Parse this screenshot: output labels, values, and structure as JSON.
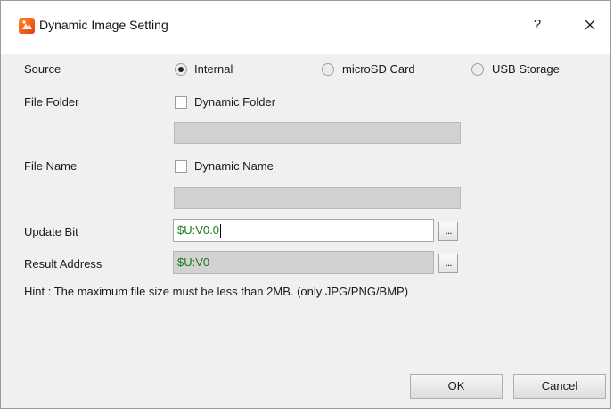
{
  "window": {
    "title": "Dynamic Image Setting",
    "help_label": "?",
    "close_label": "×",
    "icons": {
      "app": "app-logo-icon",
      "close": "close-icon"
    }
  },
  "source": {
    "label": "Source",
    "options": [
      {
        "label": "Internal",
        "checked": true
      },
      {
        "label": "microSD Card",
        "checked": false
      },
      {
        "label": "USB Storage",
        "checked": false
      }
    ]
  },
  "file_folder": {
    "label": "File Folder",
    "checkbox_label": "Dynamic Folder",
    "checked": false,
    "value": ""
  },
  "file_name": {
    "label": "File Name",
    "checkbox_label": "Dynamic Name",
    "checked": false,
    "value": ""
  },
  "update_bit": {
    "label": "Update Bit",
    "value": "$U:V0.0",
    "browse_label": "..."
  },
  "result_address": {
    "label": "Result Address",
    "value": "$U:V0",
    "browse_label": "..."
  },
  "hint": "Hint : The maximum file size must be less than 2MB. (only JPG/PNG/BMP)",
  "buttons": {
    "ok": "OK",
    "cancel": "Cancel"
  },
  "colors": {
    "dialog_background": "#f0f0f0",
    "address_text": "#1a7a1a",
    "disabled_field": "#d2d2d2"
  }
}
